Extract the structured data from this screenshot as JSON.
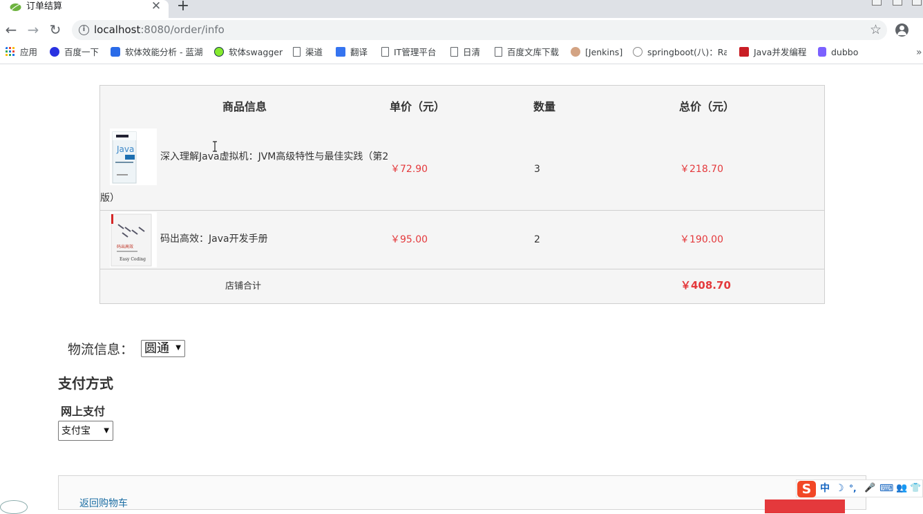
{
  "browser": {
    "tab_title": "订单结算",
    "tab_close": "✕",
    "new_tab": "+",
    "url_host": "localhost",
    "url_rest": ":8080/order/info",
    "nav_back": "←",
    "nav_forward": "→",
    "nav_reload": "↻",
    "star": "☆",
    "bookmarks": [
      {
        "label": "应用",
        "icon": "apps-grid-icon"
      },
      {
        "label": "百度一下",
        "icon": "baidu-paw-icon"
      },
      {
        "label": "软体效能分析 - 蓝湖",
        "icon": "lanhu-icon"
      },
      {
        "label": "软体swagger",
        "icon": "swagger-icon"
      },
      {
        "label": "渠道",
        "icon": "document-icon"
      },
      {
        "label": "翻译",
        "icon": "translate-icon"
      },
      {
        "label": "IT管理平台",
        "icon": "document-icon"
      },
      {
        "label": "日清",
        "icon": "document-icon"
      },
      {
        "label": "百度文库下载",
        "icon": "document-icon"
      },
      {
        "label": "[Jenkins]",
        "icon": "jenkins-icon"
      },
      {
        "label": "springboot(八)：Ra",
        "icon": "globe-icon"
      },
      {
        "label": "Java并发编程",
        "icon": "csdn-icon"
      },
      {
        "label": "dubbo",
        "icon": "dubbo-icon"
      }
    ],
    "bookmarks_more": "»"
  },
  "cart": {
    "headers": {
      "product": "商品信息",
      "unit_price": "单价（元）",
      "quantity": "数量",
      "total": "总价（元）"
    },
    "items": [
      {
        "name_line1": "深入理解Java虚拟机：JVM高级特性与最佳实践（第2",
        "name_line2": "版）",
        "price": "￥72.90",
        "quantity": "3",
        "total": "￥218.70"
      },
      {
        "name_line1": "码出高效：Java开发手册",
        "name_line2": "",
        "price": "￥95.00",
        "quantity": "2",
        "total": "￥190.00"
      }
    ],
    "store_total_label": "店铺合计",
    "store_total_value": "￥408.70"
  },
  "logistics": {
    "label": "物流信息：",
    "selected": "圆通"
  },
  "payment": {
    "heading": "支付方式",
    "online_label": "网上支付",
    "selected": "支付宝"
  },
  "footer": {
    "back_to_cart": "返回购物车"
  },
  "ime": {
    "logo": "S",
    "mode": "中",
    "items": [
      "☽",
      "°,",
      "🎤",
      "⌨",
      "👥",
      "👕"
    ]
  },
  "colors": {
    "price_red": "#e4393c",
    "link_blue": "#1c6ea4",
    "table_bg": "#f5f5f5"
  }
}
